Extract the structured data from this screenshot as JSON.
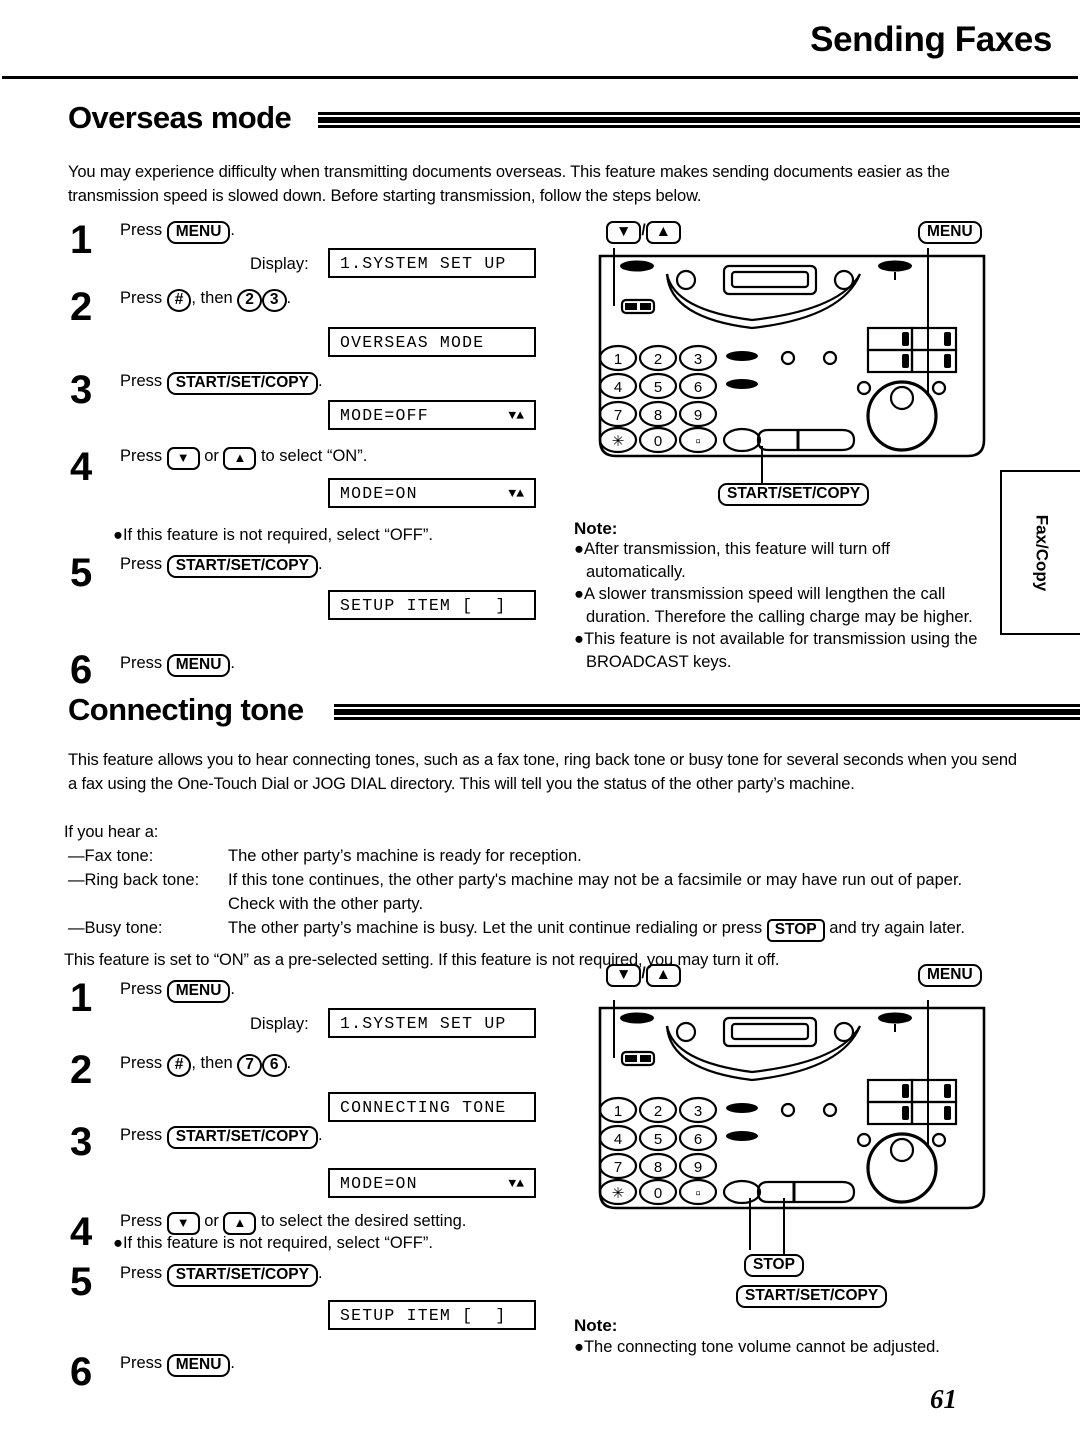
{
  "header": {
    "title": "Sending Faxes"
  },
  "page_number": "61",
  "side_tab": {
    "label": "Fax/Copy"
  },
  "sections": [
    {
      "heading": "Overseas mode",
      "intro": "You may experience difficulty when transmitting documents overseas. This feature makes sending documents easier as the transmission speed is slowed down. Before starting transmission, follow the steps below.",
      "steps": [
        {
          "num": "1",
          "pre": "Press ",
          "keys": [
            "MENU"
          ],
          "post": "."
        },
        {
          "num": "2",
          "pre": "Press ",
          "keys": [
            "#"
          ],
          "mid": ", then ",
          "keys2": [
            "2",
            "3"
          ],
          "post": "."
        },
        {
          "num": "3",
          "pre": "Press ",
          "keys": [
            "START/SET/COPY"
          ],
          "post": "."
        },
        {
          "num": "4",
          "pre": "Press ",
          "keys": [
            "▼",
            "▲"
          ],
          "post": " to select “ON”."
        },
        {
          "num": "5",
          "pre": "Press ",
          "keys": [
            "START/SET/COPY"
          ],
          "post": "."
        },
        {
          "num": "6",
          "pre": "Press ",
          "keys": [
            "MENU"
          ],
          "post": "."
        }
      ],
      "display_label": "Display:",
      "lcds": [
        {
          "main": "1.SYSTEM SET UP",
          "arrows": ""
        },
        {
          "main": "OVERSEAS MODE",
          "arrows": ""
        },
        {
          "main": "MODE=OFF",
          "arrows": "▼▲"
        },
        {
          "main": "MODE=ON",
          "arrows": "▼▲"
        },
        {
          "main": "SETUP ITEM [  ]",
          "arrows": ""
        }
      ],
      "bullet_off": "●If this feature is not required, select “OFF”.",
      "note_title": "Note:",
      "notes": [
        "●After transmission, this feature will turn off automatically.",
        "●A slower transmission speed will lengthen the call duration. Therefore the calling charge may be higher.",
        "●This feature is not available for transmission using the BROADCAST keys."
      ],
      "diagram_callouts": {
        "updown": "/",
        "down_key": "▼",
        "up_key": "▲",
        "menu": "MENU",
        "startsetcopy": "START/SET/COPY"
      }
    },
    {
      "heading": "Connecting tone",
      "intro_lines": [
        "This feature allows you to hear connecting tones, such as a fax tone, ring back tone or busy tone for several",
        "seconds when you send a fax using the One-Touch Dial or JOG DIAL directory. This will tell you the status of",
        "the other party’s machine.",
        "If you hear a:"
      ],
      "tone_rows": [
        {
          "label": "—Fax tone:",
          "desc": "The other party’s machine is ready for reception."
        },
        {
          "label": "—Ring back tone:",
          "desc": "If this tone continues, the other party's machine may not be a facsimile or may have run out of paper. Check with the other party."
        },
        {
          "label": "—Busy tone:",
          "desc_a": "The other party’s machine is busy. Let the unit continue redialing or press ",
          "desc_key": "STOP",
          "desc_b": " and try again later."
        }
      ],
      "preselect": "This feature is set to “ON” as a pre-selected setting. If this feature is not required, you may turn it off.",
      "steps": [
        {
          "num": "1",
          "pre": "Press ",
          "keys": [
            "MENU"
          ],
          "post": "."
        },
        {
          "num": "2",
          "pre": "Press ",
          "keys": [
            "#"
          ],
          "mid": ", then ",
          "keys2": [
            "7",
            "6"
          ],
          "post": "."
        },
        {
          "num": "3",
          "pre": "Press ",
          "keys": [
            "START/SET/COPY"
          ],
          "post": "."
        },
        {
          "num": "4",
          "pre": "Press ",
          "keys": [
            "▼",
            "▲"
          ],
          "post": " to select the desired setting."
        },
        {
          "num": "5",
          "pre": "Press ",
          "keys": [
            "START/SET/COPY"
          ],
          "post": "."
        },
        {
          "num": "6",
          "pre": "Press ",
          "keys": [
            "MENU"
          ],
          "post": "."
        }
      ],
      "display_label": "Display:",
      "lcds": [
        {
          "main": "1.SYSTEM SET UP",
          "arrows": ""
        },
        {
          "main": "CONNECTING TONE",
          "arrows": ""
        },
        {
          "main": "MODE=ON",
          "arrows": "▼▲"
        },
        {
          "main": "SETUP ITEM [  ]",
          "arrows": ""
        }
      ],
      "bullet_off": "●If this feature is not required, select “OFF”.",
      "note_title": "Note:",
      "notes": [
        "●The connecting tone volume cannot be adjusted."
      ],
      "diagram_callouts": {
        "menu": "MENU",
        "down_key": "▼",
        "up_key": "▲",
        "stop": "STOP",
        "startsetcopy": "START/SET/COPY"
      }
    }
  ],
  "keypad": {
    "rows": [
      [
        "1",
        "2",
        "3"
      ],
      [
        "4",
        "5",
        "6"
      ],
      [
        "7",
        "8",
        "9"
      ],
      [
        "∗",
        "0",
        "□"
      ]
    ]
  }
}
